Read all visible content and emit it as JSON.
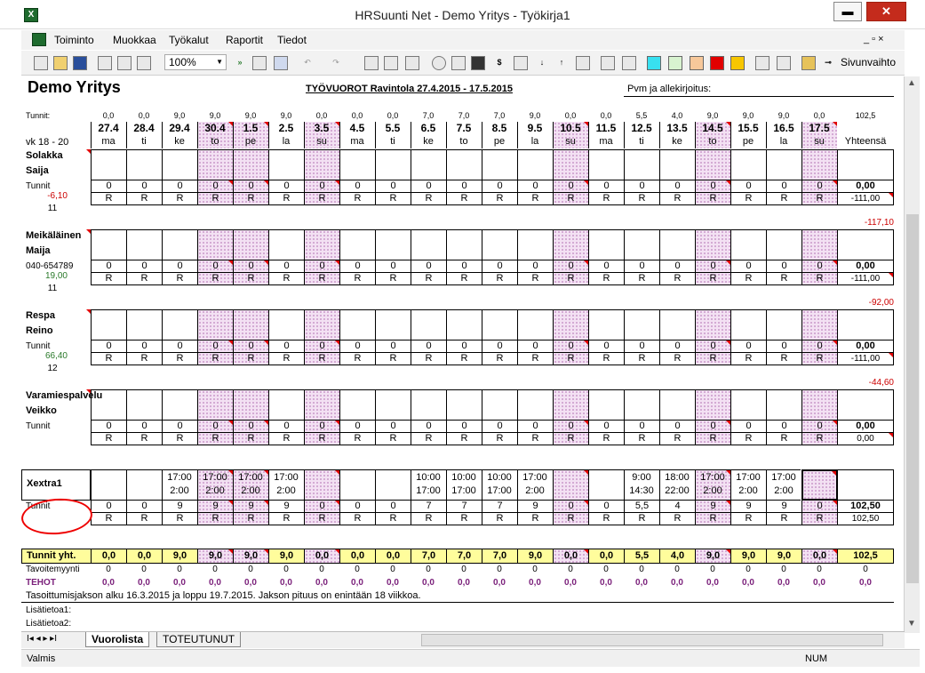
{
  "window": {
    "title": "HRSuunti Net  -  Demo Yritys - Työkirja1",
    "min": "▬",
    "max": "▢",
    "close": "✕"
  },
  "menu": [
    "Toiminto",
    "Muokkaa",
    "Työkalut",
    "Raportit",
    "Tiedot"
  ],
  "menu_right": "_ ▫ ×",
  "toolbar": {
    "zoom": "100%",
    "page_switch": "Sivunvaihto"
  },
  "colors": {
    "accent_pink": "#f3e1f3",
    "total_yellow": "#fffd9c",
    "marker_red": "#e00000",
    "tehot_purple": "#7a1f7a"
  },
  "sheet": {
    "company": "Demo Yritys",
    "title": "TYÖVUOROT  Ravintola  27.4.2015 - 17.5.2015",
    "signature": "Pvm ja allekirjoitus:",
    "hours_label": "Tunnit:",
    "week_label": "vk 18 - 20",
    "total_label": "Yhteensä",
    "day_hours": [
      "0,0",
      "0,0",
      "9,0",
      "9,0",
      "9,0",
      "9,0",
      "0,0",
      "0,0",
      "0,0",
      "7,0",
      "7,0",
      "7,0",
      "9,0",
      "0,0",
      "0,0",
      "5,5",
      "4,0",
      "9,0",
      "9,0",
      "9,0",
      "0,0"
    ],
    "day_hours_total": "102,5",
    "dates": [
      "27.4",
      "28.4",
      "29.4",
      "30.4",
      "1.5",
      "2.5",
      "3.5",
      "4.5",
      "5.5",
      "6.5",
      "7.5",
      "8.5",
      "9.5",
      "10.5",
      "11.5",
      "12.5",
      "13.5",
      "14.5",
      "15.5",
      "16.5",
      "17.5"
    ],
    "weekdays": [
      "ma",
      "ti",
      "ke",
      "to",
      "pe",
      "la",
      "su",
      "ma",
      "ti",
      "ke",
      "to",
      "pe",
      "la",
      "su",
      "ma",
      "ti",
      "ke",
      "to",
      "pe",
      "la",
      "su"
    ],
    "employees": [
      {
        "name1": "Solakka",
        "name2": "Saija",
        "info": "Tunnit",
        "balance": "-6,10",
        "num": "11",
        "total": "0,00",
        "rtotal": "-111,00",
        "after": "-117,10"
      },
      {
        "name1": "Meikäläinen",
        "name2": "Maija",
        "info": "040-654789",
        "balance": "19,00",
        "num": "11",
        "total": "0,00",
        "rtotal": "-111,00",
        "after": "-92,00"
      },
      {
        "name1": "Respa",
        "name2": "Reino",
        "info": "Tunnit",
        "balance": "66,40",
        "num": "12",
        "total": "0,00",
        "rtotal": "-111,00",
        "after": "-44,60"
      },
      {
        "name1": "Varamiespalvelu",
        "name2": "Veikko",
        "info": "Tunnit",
        "balance": "",
        "num": "",
        "total": "0,00",
        "rtotal": "0,00",
        "after": ""
      }
    ],
    "extra": {
      "name": "Xextra1",
      "info": "Tunnit",
      "shift_start": [
        "",
        "",
        "17:00",
        "17:00",
        "17:00",
        "17:00",
        "",
        "",
        "",
        "10:00",
        "10:00",
        "10:00",
        "17:00",
        "",
        "",
        "9:00",
        "18:00",
        "17:00",
        "17:00",
        "17:00",
        ""
      ],
      "shift_end": [
        "",
        "",
        "2:00",
        "2:00",
        "2:00",
        "2:00",
        "",
        "",
        "",
        "17:00",
        "17:00",
        "17:00",
        "2:00",
        "",
        "",
        "14:30",
        "22:00",
        "2:00",
        "2:00",
        "2:00",
        ""
      ],
      "hours": [
        "0",
        "0",
        "9",
        "9",
        "9",
        "9",
        "0",
        "0",
        "0",
        "7",
        "7",
        "7",
        "9",
        "0",
        "0",
        "5,5",
        "4",
        "9",
        "9",
        "9",
        "0"
      ],
      "total": "102,50",
      "rtotal": "102,50"
    },
    "totals": {
      "label": "Tunnit yht.",
      "values": [
        "0,0",
        "0,0",
        "9,0",
        "9,0",
        "9,0",
        "9,0",
        "0,0",
        "0,0",
        "0,0",
        "7,0",
        "7,0",
        "7,0",
        "9,0",
        "0,0",
        "0,0",
        "5,5",
        "4,0",
        "9,0",
        "9,0",
        "9,0",
        "0,0"
      ],
      "sum": "102,5"
    },
    "target": {
      "label": "Tavoitemyynti",
      "value": "0"
    },
    "tehot": {
      "label": "TEHOT",
      "value": "0,0"
    },
    "note": "Tasoittumisjakson alku 16.3.2015 ja loppu 19.7.2015.  Jakson pituus on enintään 18 viikkoa.",
    "extra1": "Lisätietoa1:",
    "extra2": "Lisätietoa2:",
    "r_label": "R",
    "zero": "0"
  },
  "tabs": {
    "nav": "I◂ ◂ ▸ ▸I",
    "active": "Vuorolista",
    "other": "TOTEUTUNUT"
  },
  "status": {
    "left": "Valmis",
    "right": "NUM"
  }
}
